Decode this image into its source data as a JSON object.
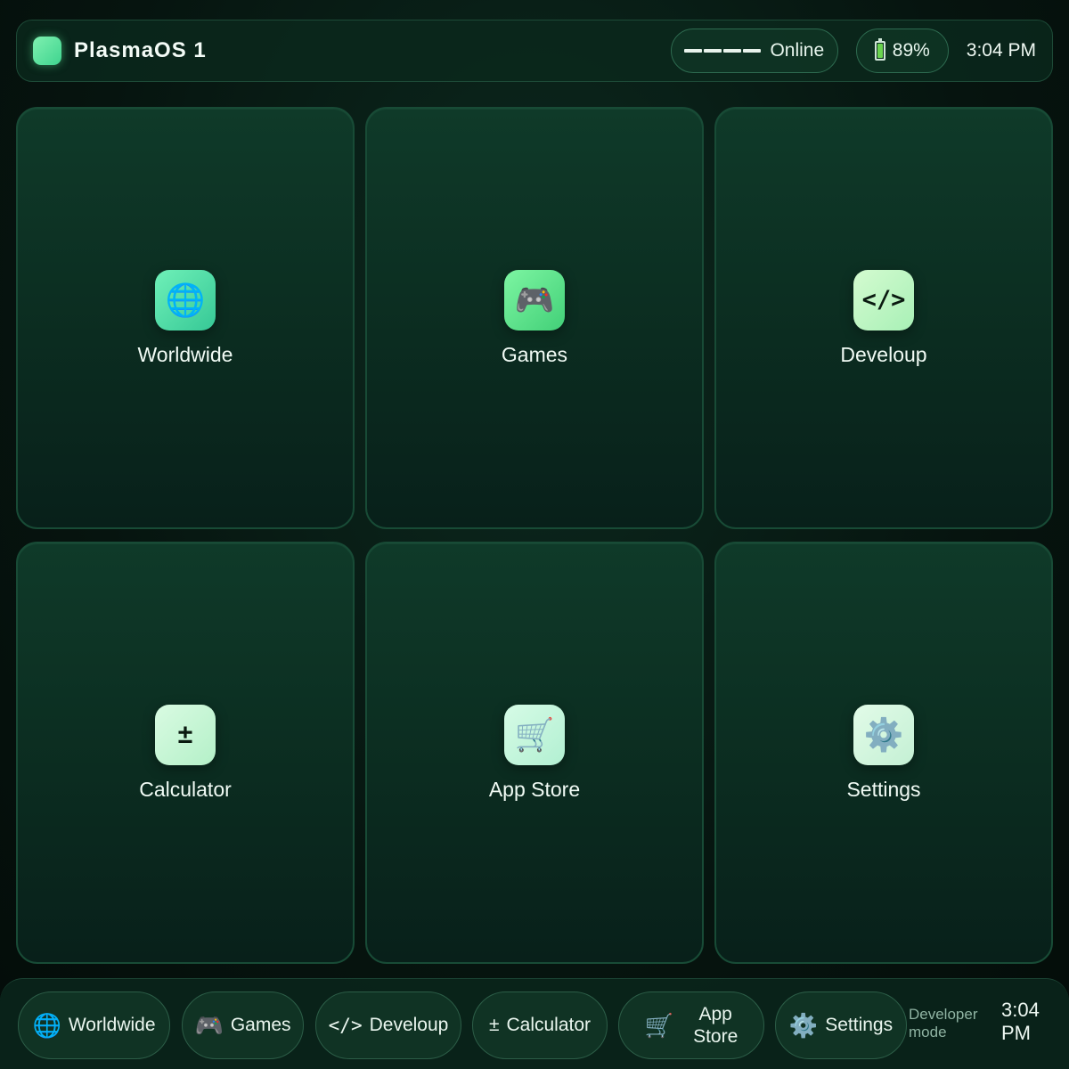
{
  "topbar": {
    "title": "PlasmaOS 1",
    "network_status": "Online",
    "battery": "89%",
    "battery_level": 0.89,
    "time": "3:04 PM"
  },
  "apps": [
    {
      "label": "Worldwide",
      "icon": "globe-icon"
    },
    {
      "label": "Games",
      "icon": "gamepad-icon"
    },
    {
      "label": "Develoup",
      "icon": "code-icon",
      "glyph": "</>"
    },
    {
      "label": "Calculator",
      "icon": "plus-minus-icon",
      "glyph": "±"
    },
    {
      "label": "App Store",
      "icon": "shopping-cart-icon"
    },
    {
      "label": "Settings",
      "icon": "gear-icon"
    }
  ],
  "dock": {
    "items": [
      {
        "label": "Worldwide",
        "icon": "globe-icon"
      },
      {
        "label": "Games",
        "icon": "gamepad-icon"
      },
      {
        "label": "Develoup",
        "icon": "code-icon",
        "glyph": "</>"
      },
      {
        "label": "Calculator",
        "icon": "plus-minus-icon",
        "glyph": "±"
      },
      {
        "label": "App Store",
        "label_line1": "App",
        "label_line2": "Store",
        "icon": "shopping-cart-icon"
      },
      {
        "label": "Settings",
        "icon": "gear-icon"
      }
    ],
    "status": "Developer mode",
    "time_line1": "3:04",
    "time_line2": "PM"
  },
  "colors": {
    "accent": "#3fd48f",
    "background": "#06140f",
    "tile": "#0f3a29",
    "border": "#184b36"
  }
}
